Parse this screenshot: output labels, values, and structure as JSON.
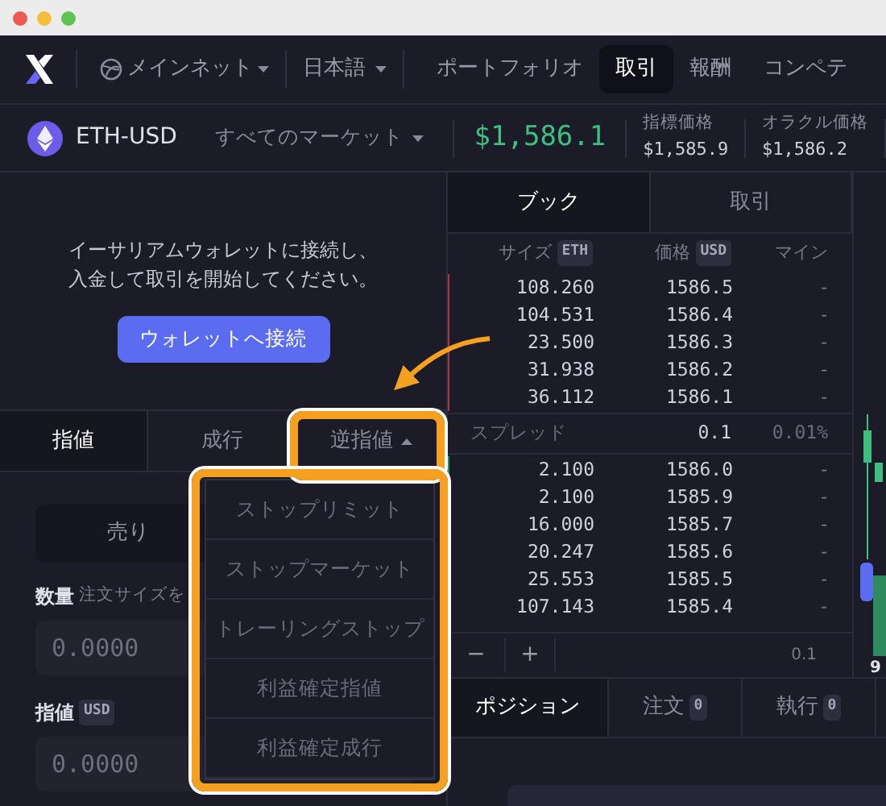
{
  "nav": {
    "network": "メインネット",
    "language": "日本語",
    "links": [
      {
        "label": "ポートフォリオ",
        "selected": false
      },
      {
        "label": "取引",
        "selected": true
      },
      {
        "label": "報酬",
        "selected": false
      },
      {
        "label": "コンペテ",
        "selected": false
      }
    ]
  },
  "market": {
    "symbol": "ETH-USD",
    "selector": "すべてのマーケット",
    "price": "$1,586.1",
    "stats": [
      {
        "label": "指標価格",
        "value": "$1,585.9"
      },
      {
        "label": "オラクル価格",
        "value": "$1,586.2"
      }
    ]
  },
  "connect": {
    "message_lines": [
      "イーサリアムウォレットに接続し、",
      "入金して取引を開始してください。"
    ],
    "button": "ウォレットへ接続"
  },
  "order_types": [
    {
      "label": "指値",
      "selected": true,
      "kind": "tab"
    },
    {
      "label": "成行",
      "selected": false,
      "kind": "tab"
    },
    {
      "label": "逆指値",
      "selected": false,
      "kind": "dropdown",
      "expanded": true
    }
  ],
  "order_form": {
    "side_button": "売り",
    "size_label": "数量",
    "size_hint": "注文サイズを",
    "size_placeholder": "0.0000",
    "price_label": "指値",
    "price_unit": "USD",
    "price_placeholder": "0.0000"
  },
  "stop_menu": [
    "ストップリミット",
    "ストップマーケット",
    "トレーリングストップ",
    "利益確定指値",
    "利益確定成行"
  ],
  "book": {
    "tabs": [
      {
        "label": "ブック",
        "selected": true
      },
      {
        "label": "取引",
        "selected": false
      }
    ],
    "columns": [
      {
        "label": "サイズ",
        "unit": "ETH"
      },
      {
        "label": "価格",
        "unit": "USD"
      },
      {
        "label": "マイン"
      }
    ],
    "asks": [
      {
        "size": "108.260",
        "price": "1586.5",
        "mine": "-"
      },
      {
        "size": "104.531",
        "price": "1586.4",
        "mine": "-"
      },
      {
        "size": "23.500",
        "price": "1586.3",
        "mine": "-"
      },
      {
        "size": "31.938",
        "price": "1586.2",
        "mine": "-"
      },
      {
        "size": "36.112",
        "price": "1586.1",
        "mine": "-"
      }
    ],
    "spread": {
      "label": "スプレッド",
      "value": "0.1",
      "percent": "0.01%"
    },
    "bids": [
      {
        "size": "2.100",
        "price": "1586.0",
        "mine": "-"
      },
      {
        "size": "2.100",
        "price": "1585.9",
        "mine": "-"
      },
      {
        "size": "16.000",
        "price": "1585.7",
        "mine": "-"
      },
      {
        "size": "20.247",
        "price": "1585.6",
        "mine": "-"
      },
      {
        "size": "25.553",
        "price": "1585.5",
        "mine": "-"
      },
      {
        "size": "107.143",
        "price": "1585.4",
        "mine": "-"
      }
    ],
    "controls": {
      "minus": "−",
      "plus": "+",
      "tick": "0.1"
    }
  },
  "chart": {
    "axis_label": "9"
  },
  "bottom_tabs": [
    {
      "label": "ポジション",
      "selected": true
    },
    {
      "label": "注文",
      "count": "0",
      "selected": false
    },
    {
      "label": "執行",
      "count": "0",
      "selected": false
    }
  ]
}
